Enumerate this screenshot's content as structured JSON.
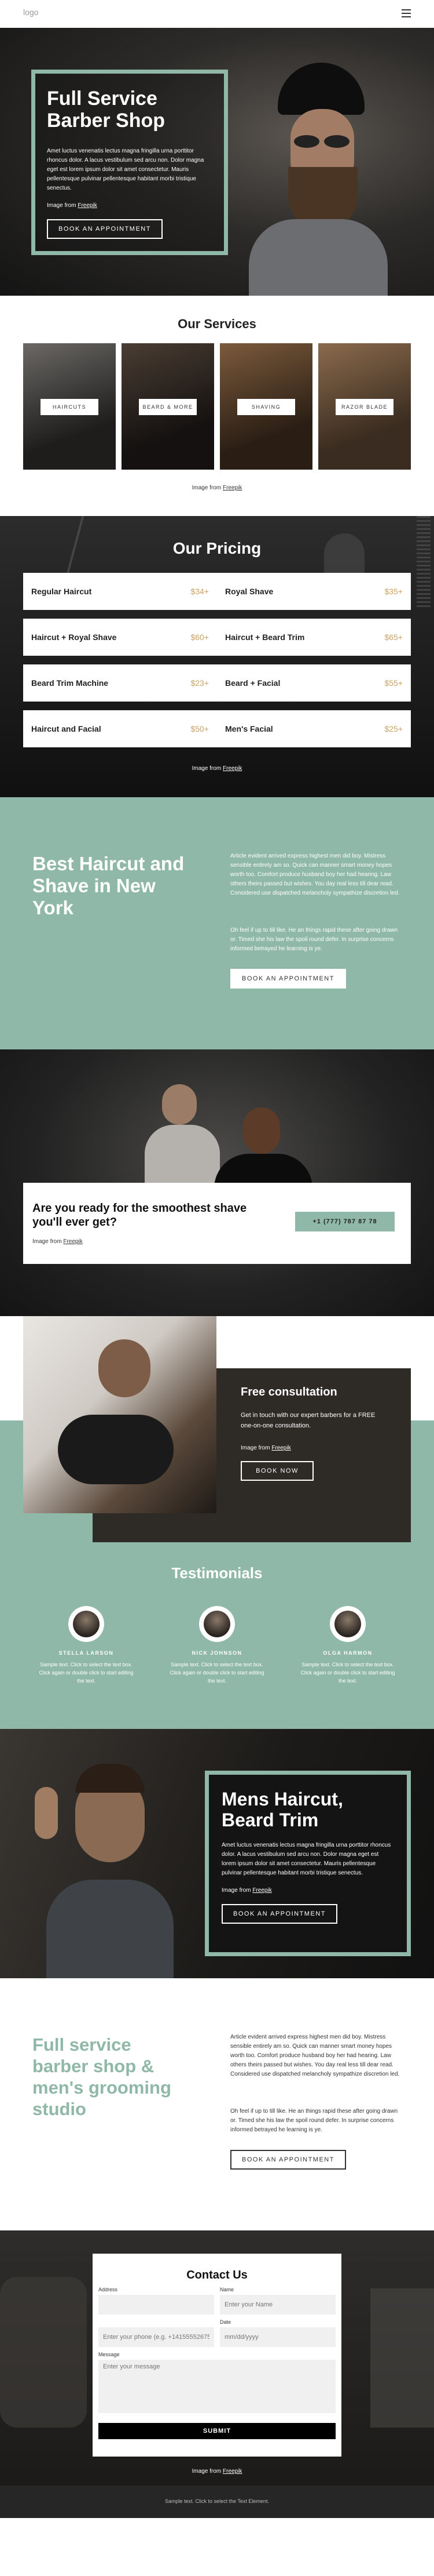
{
  "header": {
    "logo": "logo",
    "menu_icon": "menu-icon"
  },
  "hero": {
    "title": "Full Service Barber Shop",
    "text": "Amet luctus venenatis lectus magna fringilla urna porttitor rhoncus dolor. A lacus vestibulum sed arcu non. Dolor magna eget est lorem ipsum dolor sit amet consectetur. Mauris pellentesque pulvinar pellentesque habitant morbi tristique senectus.",
    "credit_prefix": "Image from ",
    "credit_link": "Freepik",
    "button": "BOOK AN APPOINTMENT"
  },
  "services": {
    "title": "Our Services",
    "items": [
      "HAIRCUTS",
      "BEARD & MORE",
      "SHAVING",
      "RAZOR BLADE"
    ],
    "credit_prefix": "Image from ",
    "credit_link": "Freepik"
  },
  "pricing": {
    "title": "Our Pricing",
    "left": [
      {
        "name": "Regular Haircut",
        "price": "$34+"
      },
      {
        "name": "Haircut + Royal Shave",
        "price": "$60+"
      },
      {
        "name": "Beard Trim Machine",
        "price": "$23+"
      },
      {
        "name": "Haircut and Facial",
        "price": "$50+"
      }
    ],
    "right": [
      {
        "name": "Royal Shave",
        "price": "$35+"
      },
      {
        "name": "Haircut + Beard Trim",
        "price": "$65+"
      },
      {
        "name": "Beard + Facial",
        "price": "$55+"
      },
      {
        "name": "Men's Facial",
        "price": "$25+"
      }
    ],
    "credit_prefix": "Image from ",
    "credit_link": "Freepik"
  },
  "best": {
    "title": "Best Haircut and Shave in New York",
    "p1": "Article evident arrived express highest men did boy. Mistress sensible entirely am so. Quick can manner smart money hopes worth too. Comfort produce husband boy her had hearing. Law others theirs passed but wishes. You day real less till dear read. Considered use dispatched melancholy sympathize discretion led.",
    "p2": "Oh feel if up to till like. He an things rapid these after going drawn or. Timed she his law the spoil round defer. In surprise concerns informed betrayed he learning is ye.",
    "button": "BOOK AN APPOINTMENT"
  },
  "cta": {
    "title": "Are you ready for the smoothest shave you'll ever get?",
    "credit_prefix": "Image from ",
    "credit_link": "Freepik",
    "phone": "+1 (777) 787 87 78"
  },
  "consult": {
    "title": "Free consultation",
    "text": "Get in touch with our expert barbers for a FREE one-on-one consultation.",
    "credit_prefix": "Image from ",
    "credit_link": "Freepik",
    "button": "BOOK NOW"
  },
  "testimonials": {
    "title": "Testimonials",
    "items": [
      {
        "name": "STELLA LARSON",
        "text": "Sample text. Click to select the text box. Click again or double click to start editing the text."
      },
      {
        "name": "NICK JOHNSON",
        "text": "Sample text. Click to select the text box. Click again or double click to start editing the text."
      },
      {
        "name": "OLGA HARMON",
        "text": "Sample text. Click to select the text box. Click again or double click to start editing the text."
      }
    ]
  },
  "mens": {
    "title": "Mens Haircut, Beard Trim",
    "text": "Amet luctus venenatis lectus magna fringilla urna porttitor rhoncus dolor. A lacus vestibulum sed arcu non. Dolor magna eget est lorem ipsum dolor sit amet consectetur. Mauris pellentesque pulvinar pellentesque habitant morbi tristique senectus.",
    "credit_prefix": "Image from ",
    "credit_link": "Freepik",
    "button": "BOOK AN APPOINTMENT"
  },
  "studio": {
    "title": "Full service barber shop & men's grooming studio",
    "p1": "Article evident arrived express highest men did boy. Mistress sensible entirely am so. Quick can manner smart money hopes worth too. Comfort produce husband boy her had hearing. Law others theirs passed but wishes. You day real less till dear read. Considered use dispatched melancholy sympathize discretion led.",
    "p2": "Oh feel if up to till like. He an things rapid these after going drawn or. Timed she his law the spoil round defer. In surprise concerns informed betrayed he learning is ye.",
    "button": "BOOK AN APPOINTMENT"
  },
  "contact": {
    "title": "Contact Us",
    "address_label": "Address",
    "name_label": "Name",
    "name_placeholder": "Enter your Name",
    "phone_placeholder": "Enter your phone (e.g. +14155552675)",
    "date_label": "Date",
    "date_placeholder": "mm/dd/yyyy",
    "message_label": "Message",
    "message_placeholder": "Enter your message",
    "submit": "SUBMIT",
    "credit_prefix": "Image from ",
    "credit_link": "Freepik"
  },
  "footer": {
    "text": "Sample text. Click to select the Text Element."
  },
  "colors": {
    "accent": "#8fb8a8",
    "price": "#caa36a",
    "dark": "#1a1a1a"
  }
}
